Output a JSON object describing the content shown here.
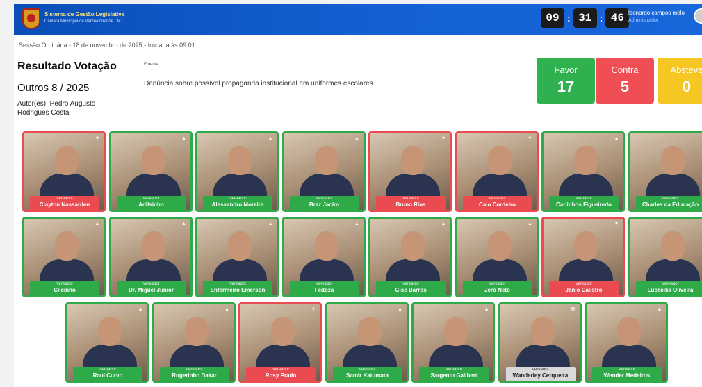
{
  "header": {
    "system_name": "Sistema de Gestão Legislativa",
    "chamber_name": "Câmara Municipal de Várzea Grande · MT",
    "clock": {
      "hours": "09",
      "minutes": "31",
      "seconds": "46",
      "sep": ":"
    },
    "user": {
      "name": "leonardo campos melo",
      "role": "Administrador"
    }
  },
  "session": "Sessão Ordinária - 18 de novembro de 2025 - Iniciada às 09:01",
  "result": {
    "title": "Resultado Votação",
    "proceeding": "Outros 8 / 2025",
    "author": "Autor(es): Pedro Augusto Rodrigues Costa",
    "ementa_label": "Ementa",
    "ementa": "Denúncia sobre possível propaganda institucional em uniformes escolares"
  },
  "tally": {
    "favor": {
      "label": "Favor",
      "value": "17",
      "color": "#2fb14f"
    },
    "contra": {
      "label": "Contra",
      "value": "5",
      "color": "#f04e55"
    },
    "abstencao": {
      "label": "Absteve",
      "value": "0",
      "color": "#f6c623"
    }
  },
  "role_label": "Vereador",
  "councillors": [
    {
      "name": "Clayton Nassarden",
      "vote": "contra"
    },
    {
      "name": "Adilsinho",
      "vote": "favor"
    },
    {
      "name": "Alessandro Moreira",
      "vote": "favor"
    },
    {
      "name": "Braz Jacíro",
      "vote": "favor"
    },
    {
      "name": "Bruno Rios",
      "vote": "contra"
    },
    {
      "name": "Caio Cordeiro",
      "vote": "contra"
    },
    {
      "name": "Carlinhos Figueiredo",
      "vote": "favor"
    },
    {
      "name": "Charles da Educação",
      "vote": "favor"
    },
    {
      "name": "Cilcinho",
      "vote": "favor"
    },
    {
      "name": "Dr. Miguel Junior",
      "vote": "favor"
    },
    {
      "name": "Enfermeiro Emerson",
      "vote": "favor"
    },
    {
      "name": "Feitoza",
      "vote": "favor"
    },
    {
      "name": "Gise Barros",
      "vote": "favor"
    },
    {
      "name": "Jero Neto",
      "vote": "favor"
    },
    {
      "name": "Jânio Calistro",
      "vote": "contra"
    },
    {
      "name": "Lucécilia Oliveira",
      "vote": "favor"
    },
    {
      "name": "Raul Curvo",
      "vote": "favor"
    },
    {
      "name": "Rogerinho Dakar",
      "vote": "favor"
    },
    {
      "name": "Rosy Prado",
      "vote": "contra"
    },
    {
      "name": "Samir Katumata",
      "vote": "favor"
    },
    {
      "name": "Sargento Gailbert",
      "vote": "favor"
    },
    {
      "name": "Wanderley Cerqueira",
      "vote": "none"
    },
    {
      "name": "Wender Medeiros",
      "vote": "favor"
    }
  ]
}
